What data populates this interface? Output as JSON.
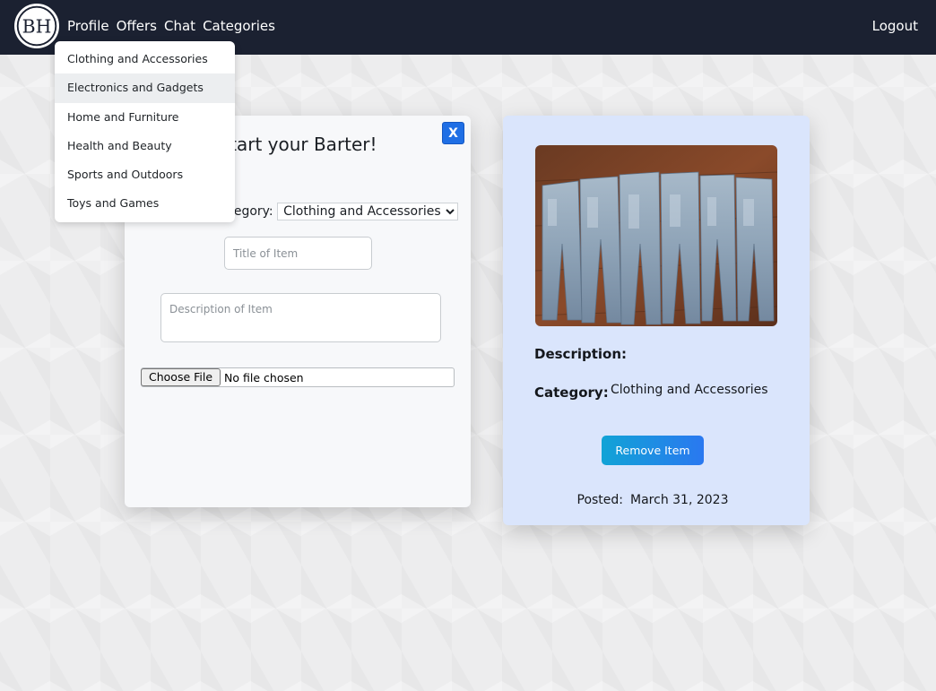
{
  "nav": {
    "logo_text": "BH",
    "links": [
      "Profile",
      "Offers",
      "Chat",
      "Categories"
    ],
    "logout": "Logout"
  },
  "dropdown": {
    "items": [
      "Clothing and Accessories",
      "Electronics and Gadgets",
      "Home and Furniture",
      "Health and Beauty",
      "Sports and Outdoors",
      "Toys and Games"
    ],
    "highlighted_index": 1
  },
  "form": {
    "close_label": "X",
    "title": "Start your Barter!",
    "category_label": "Category:",
    "category_selected": "Clothing and Accessories",
    "title_placeholder": "Title of Item",
    "description_placeholder": "Description of Item",
    "file_button": "Choose File",
    "file_status": "No file chosen"
  },
  "item": {
    "image_alt": "jeans",
    "description_label": "Description:",
    "category_label": "Category:",
    "category_value": "Clothing and Accessories",
    "remove_button": "Remove Item",
    "posted_label": "Posted:",
    "posted_date": "March 31, 2023"
  },
  "colors": {
    "navbar": "#1b2131",
    "item_card": "#dae5fc",
    "close_button": "#1f6fe5",
    "remove_gradient_start": "#11a3d6",
    "remove_gradient_end": "#2a78f0"
  }
}
